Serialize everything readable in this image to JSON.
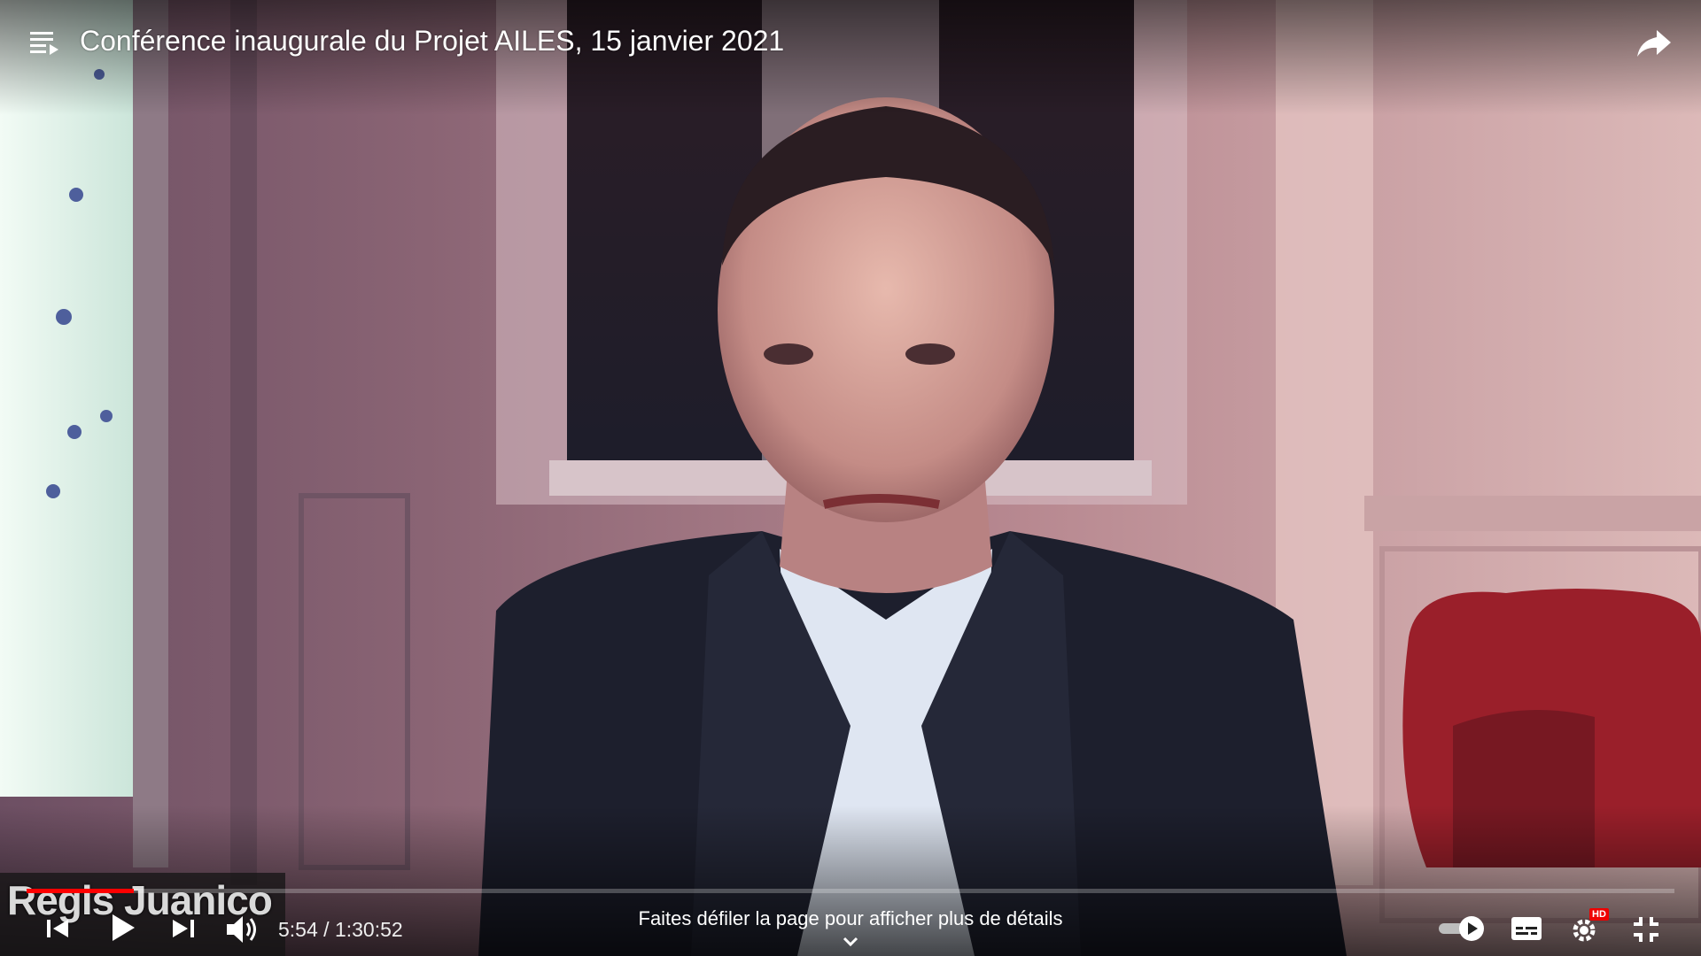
{
  "player": {
    "title": "Conférence inaugurale du Projet AILES, 15 janvier 2021",
    "speaker_name_overlay": "Regis Juanico",
    "time": {
      "current": "5:54",
      "separator": " / ",
      "duration": "1:30:52"
    },
    "progress_fraction": 0.065,
    "scroll_hint": "Faites défiler la page pour afficher plus de détails",
    "settings_badge": "HD",
    "icons": {
      "playlist": "playlist-icon",
      "share": "share-icon",
      "previous": "previous-icon",
      "play": "play-icon",
      "next": "next-icon",
      "volume": "volume-icon",
      "autoplay": "autoplay-toggle-icon",
      "subtitles": "subtitles-icon",
      "settings": "settings-gear-icon",
      "exit_fullscreen": "exit-fullscreen-icon",
      "chevron": "chevron-down-icon"
    },
    "colors": {
      "progress": "#ff0000",
      "hd_badge": "#ee0000",
      "text": "#ffffff"
    }
  }
}
